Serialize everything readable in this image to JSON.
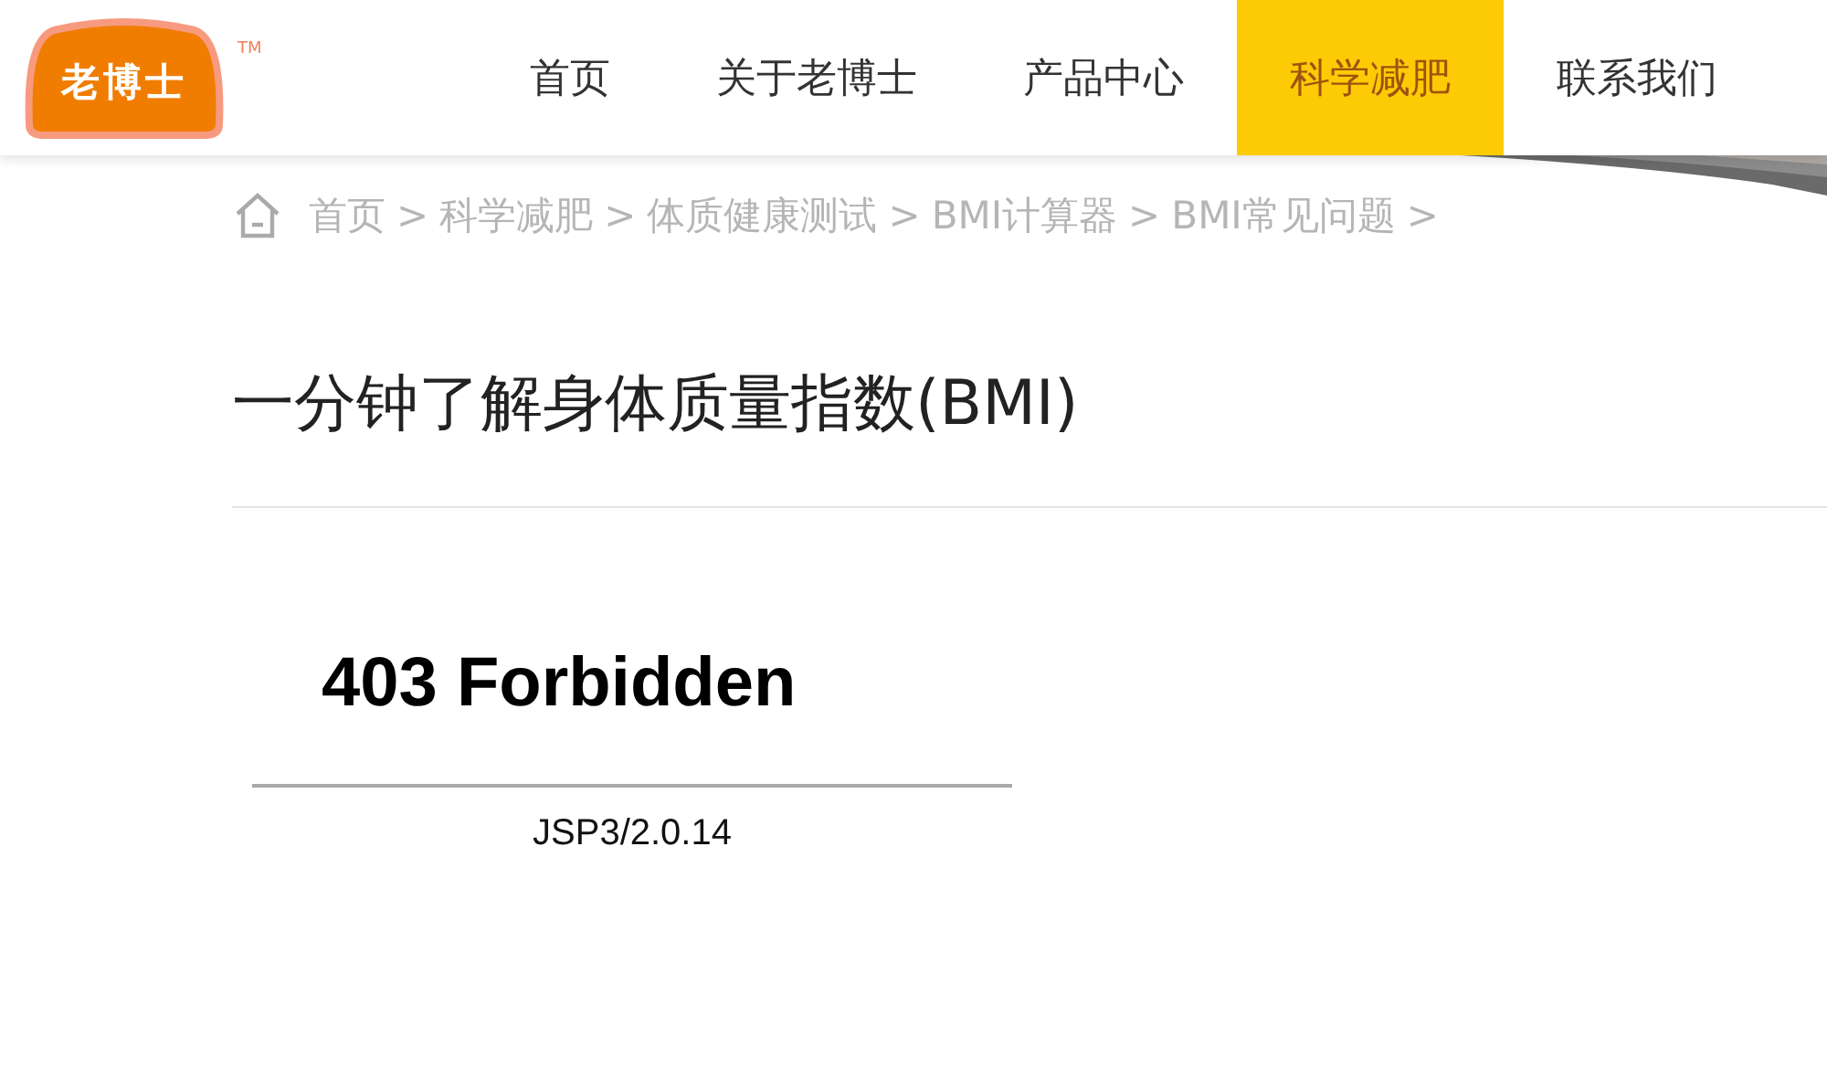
{
  "logo": {
    "text": "老博士",
    "trademark": "TM"
  },
  "nav": [
    {
      "label": "首页",
      "selected": false
    },
    {
      "label": "关于老博士",
      "selected": false
    },
    {
      "label": "产品中心",
      "selected": false
    },
    {
      "label": "科学减肥",
      "selected": true
    },
    {
      "label": "联系我们",
      "selected": false
    }
  ],
  "breadcrumb": [
    "首页",
    "科学减肥",
    "体质健康测试",
    "BMI计算器",
    "BMI常见问题"
  ],
  "breadcrumb_separator": ">",
  "title": "一分钟了解身体质量指数(BMI)",
  "error": {
    "heading": "403 Forbidden",
    "server": "JSP3/2.0.14"
  }
}
